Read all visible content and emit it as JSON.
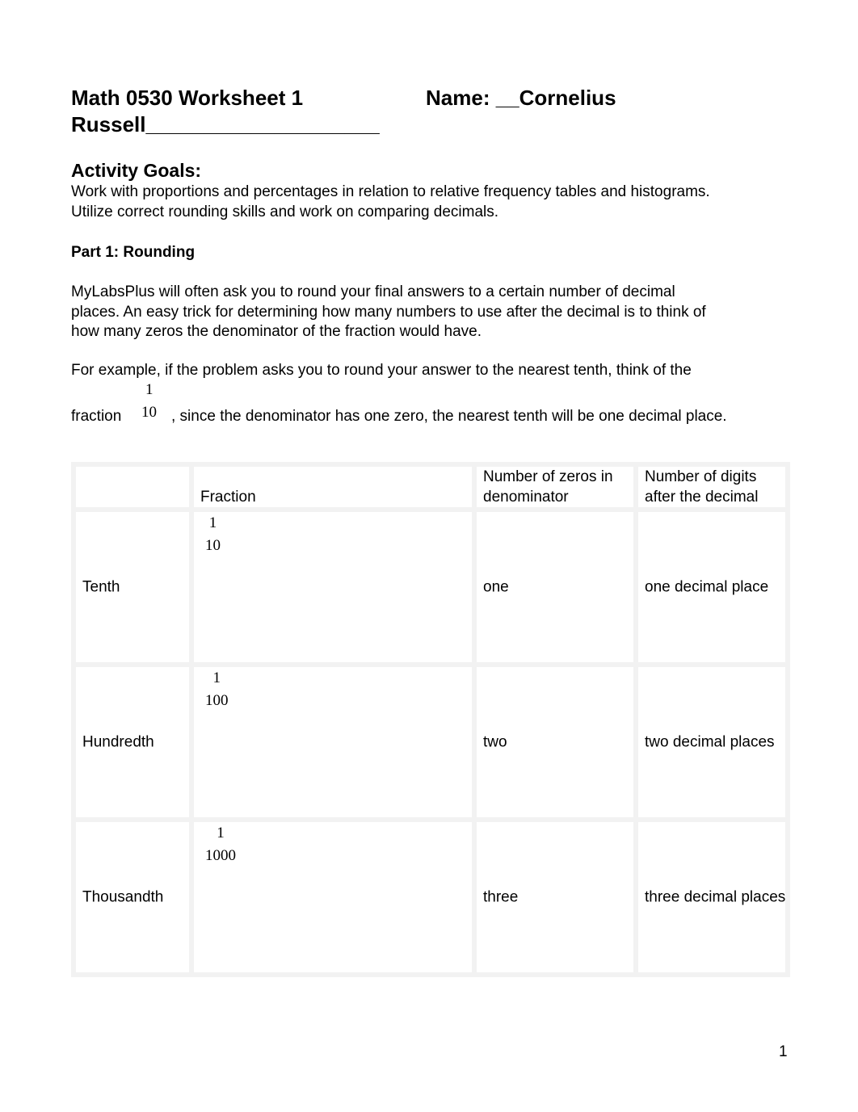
{
  "header": {
    "title": "Math 0530 Worksheet 1",
    "name_label": "Name: __Cornelius",
    "name_cont": "Russell____________________"
  },
  "goals": {
    "heading": "Activity Goals:",
    "text1": "Work with proportions and percentages in relation to relative frequency tables and histograms.",
    "text2": "Utilize correct rounding skills and work on comparing decimals."
  },
  "part1": {
    "heading": "Part 1:  Rounding",
    "para1": [
      "MyLabsPlus will often ask you to round your final answers to a certain number of decimal",
      "places. An easy trick for determining how many numbers to use after the decimal is to think of",
      "how many zeros the denominator of the fraction would have."
    ],
    "para2": "For example, if the problem asks you to round your answer to the nearest tenth, think of the",
    "fraction_word": "fraction",
    "fraction_num": "1",
    "fraction_den": "10",
    "para2_end": ", since the denominator has one zero, the nearest tenth will be one decimal place."
  },
  "table": {
    "headers": [
      "",
      "Fraction",
      "Number of zeros in denominator",
      "Number of digits after the decimal"
    ],
    "rows": [
      {
        "name": "Tenth",
        "num": "1",
        "den": "10",
        "zeros": "one",
        "digits": "one decimal place"
      },
      {
        "name": "Hundredth",
        "num": "1",
        "den": "100",
        "zeros": "two",
        "digits": "two decimal places"
      },
      {
        "name": "Thousandth",
        "num": "1",
        "den": "1000",
        "zeros": "three",
        "digits": "three decimal places"
      }
    ]
  },
  "page_number": "1"
}
